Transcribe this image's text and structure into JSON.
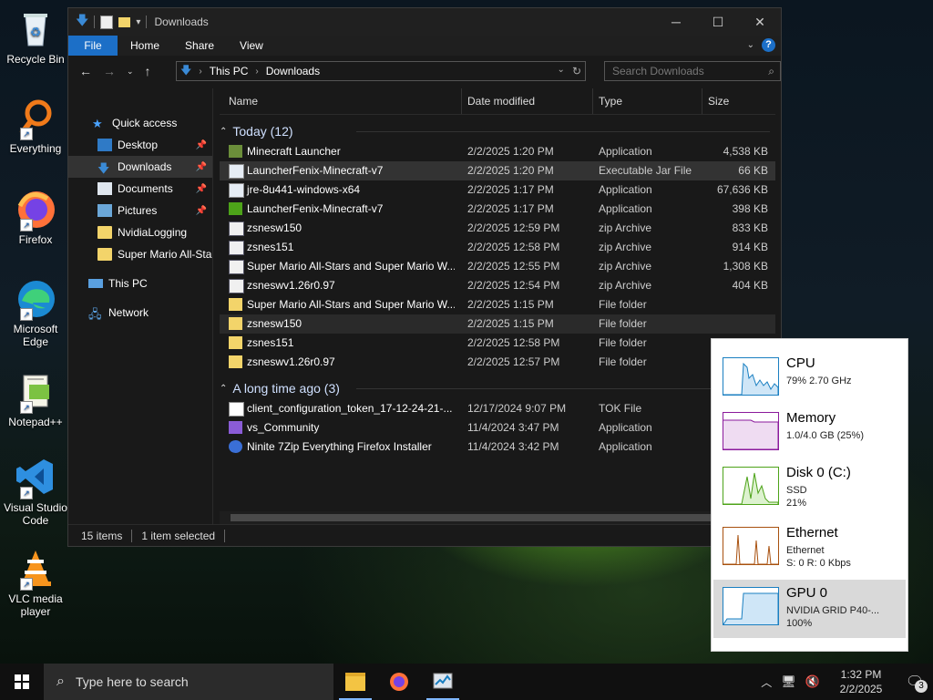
{
  "desktop": {
    "icons": [
      {
        "label": "Recycle Bin"
      },
      {
        "label": "Everything"
      },
      {
        "label": "Firefox"
      },
      {
        "label": "Microsoft Edge"
      },
      {
        "label": "Notepad++"
      },
      {
        "label": "Visual Studio Code"
      },
      {
        "label": "VLC media player"
      }
    ]
  },
  "explorer": {
    "title": "Downloads",
    "ribbon_tabs": [
      "File",
      "Home",
      "Share",
      "View"
    ],
    "breadcrumb": [
      "This PC",
      "Downloads"
    ],
    "search_placeholder": "Search Downloads",
    "sidebar": [
      {
        "label": "Quick access"
      },
      {
        "label": "Desktop"
      },
      {
        "label": "Downloads"
      },
      {
        "label": "Documents"
      },
      {
        "label": "Pictures"
      },
      {
        "label": "NvidiaLogging"
      },
      {
        "label": "Super Mario All-Sta"
      },
      {
        "label": "This PC"
      },
      {
        "label": "Network"
      }
    ],
    "columns": [
      "Name",
      "Date modified",
      "Type",
      "Size"
    ],
    "groups": [
      {
        "label": "Today (12)",
        "rows": [
          {
            "name": "Minecraft Launcher",
            "date": "2/2/2025 1:20 PM",
            "type": "Application",
            "size": "4,538 KB",
            "icon": "minecraft-icon"
          },
          {
            "name": "LauncherFenix-Minecraft-v7",
            "date": "2/2/2025 1:20 PM",
            "type": "Executable Jar File",
            "size": "66 KB",
            "icon": "java-icon"
          },
          {
            "name": "jre-8u441-windows-x64",
            "date": "2/2/2025 1:17 PM",
            "type": "Application",
            "size": "67,636 KB",
            "icon": "java-icon"
          },
          {
            "name": "LauncherFenix-Minecraft-v7",
            "date": "2/2/2025 1:17 PM",
            "type": "Application",
            "size": "398 KB",
            "icon": "creeper-icon"
          },
          {
            "name": "zsnesw150",
            "date": "2/2/2025 12:59 PM",
            "type": "zip Archive",
            "size": "833 KB",
            "icon": "zip-icon"
          },
          {
            "name": "zsnes151",
            "date": "2/2/2025 12:58 PM",
            "type": "zip Archive",
            "size": "914 KB",
            "icon": "zip-icon"
          },
          {
            "name": "Super Mario All-Stars and Super Mario W...",
            "date": "2/2/2025 12:55 PM",
            "type": "zip Archive",
            "size": "1,308 KB",
            "icon": "zip-icon"
          },
          {
            "name": "zsneswv1.26r0.97",
            "date": "2/2/2025 12:54 PM",
            "type": "zip Archive",
            "size": "404 KB",
            "icon": "zip-icon"
          },
          {
            "name": "Super Mario All-Stars and Super Mario W...",
            "date": "2/2/2025 1:15 PM",
            "type": "File folder",
            "size": "",
            "icon": "folder-icon"
          },
          {
            "name": "zsnesw150",
            "date": "2/2/2025 1:15 PM",
            "type": "File folder",
            "size": "",
            "icon": "folder-icon"
          },
          {
            "name": "zsnes151",
            "date": "2/2/2025 12:58 PM",
            "type": "File folder",
            "size": "",
            "icon": "folder-icon"
          },
          {
            "name": "zsneswv1.26r0.97",
            "date": "2/2/2025 12:57 PM",
            "type": "File folder",
            "size": "",
            "icon": "folder-icon"
          }
        ]
      },
      {
        "label": "A long time ago (3)",
        "rows": [
          {
            "name": "client_configuration_token_17-12-24-21-...",
            "date": "12/17/2024 9:07 PM",
            "type": "TOK File",
            "size": "",
            "icon": "file-icon"
          },
          {
            "name": "vs_Community",
            "date": "11/4/2024 3:47 PM",
            "type": "Application",
            "size": "",
            "icon": "vs-icon"
          },
          {
            "name": "Ninite 7Zip Everything Firefox Installer",
            "date": "11/4/2024 3:42 PM",
            "type": "Application",
            "size": "",
            "icon": "ninite-icon"
          }
        ]
      }
    ],
    "status": {
      "items": "15 items",
      "selected": "1 item selected"
    }
  },
  "perf": [
    {
      "title": "CPU",
      "lines": [
        "79%  2.70 GHz"
      ],
      "color": "#1a7fc1"
    },
    {
      "title": "Memory",
      "lines": [
        "1.0/4.0 GB (25%)"
      ],
      "color": "#8b1a9c"
    },
    {
      "title": "Disk 0 (C:)",
      "lines": [
        "SSD",
        "21%"
      ],
      "color": "#4da319"
    },
    {
      "title": "Ethernet",
      "lines": [
        "Ethernet",
        "S: 0 R: 0 Kbps"
      ],
      "color": "#a8500e"
    },
    {
      "title": "GPU 0",
      "lines": [
        "NVIDIA GRID P40-...",
        "100%"
      ],
      "color": "#1a7fc1"
    }
  ],
  "taskbar": {
    "search_placeholder": "Type here to search",
    "time": "1:32 PM",
    "date": "2/2/2025",
    "notifications": "3"
  }
}
